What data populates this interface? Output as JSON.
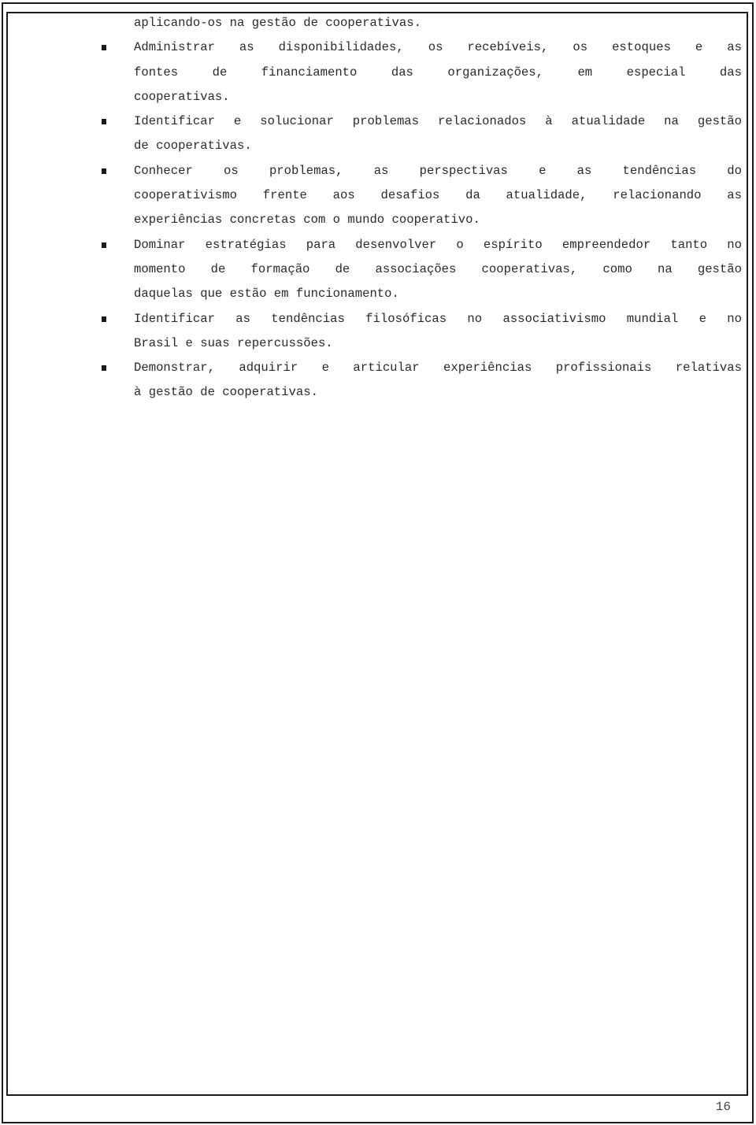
{
  "document": {
    "continuation_line": "aplicando-os na gestão de cooperativas.",
    "items": [
      {
        "lines": [
          {
            "text": "Administrar as disponibilidades, os recebíveis, os estoques e as",
            "justify": true
          },
          {
            "text": "fontes de financiamento das organizações, em especial das",
            "justify": true
          },
          {
            "text": "cooperativas.",
            "justify": false
          }
        ]
      },
      {
        "lines": [
          {
            "text": "Identificar e solucionar problemas relacionados à atualidade na gestão",
            "justify": true
          },
          {
            "text": "de cooperativas.",
            "justify": false
          }
        ]
      },
      {
        "lines": [
          {
            "text": "Conhecer os problemas, as perspectivas e as tendências do",
            "justify": true
          },
          {
            "text": "cooperativismo frente aos desafios da atualidade, relacionando as",
            "justify": true
          },
          {
            "text": "experiências concretas com o mundo cooperativo.",
            "justify": false
          }
        ]
      },
      {
        "lines": [
          {
            "text": "Dominar estratégias para desenvolver o espírito empreendedor tanto no",
            "justify": true
          },
          {
            "text": "momento de formação de associações cooperativas, como na gestão",
            "justify": true
          },
          {
            "text": "daquelas que estão em funcionamento.",
            "justify": false
          }
        ]
      },
      {
        "lines": [
          {
            "text": "Identificar as tendências filosóficas no associativismo mundial e no",
            "justify": true
          },
          {
            "text": "Brasil e suas repercussões.",
            "justify": false
          }
        ]
      },
      {
        "lines": [
          {
            "text": "Demonstrar, adquirir e articular experiências profissionais relativas",
            "justify": true
          },
          {
            "text": "à gestão de cooperativas.",
            "justify": false
          }
        ]
      }
    ],
    "page_number": "16"
  }
}
